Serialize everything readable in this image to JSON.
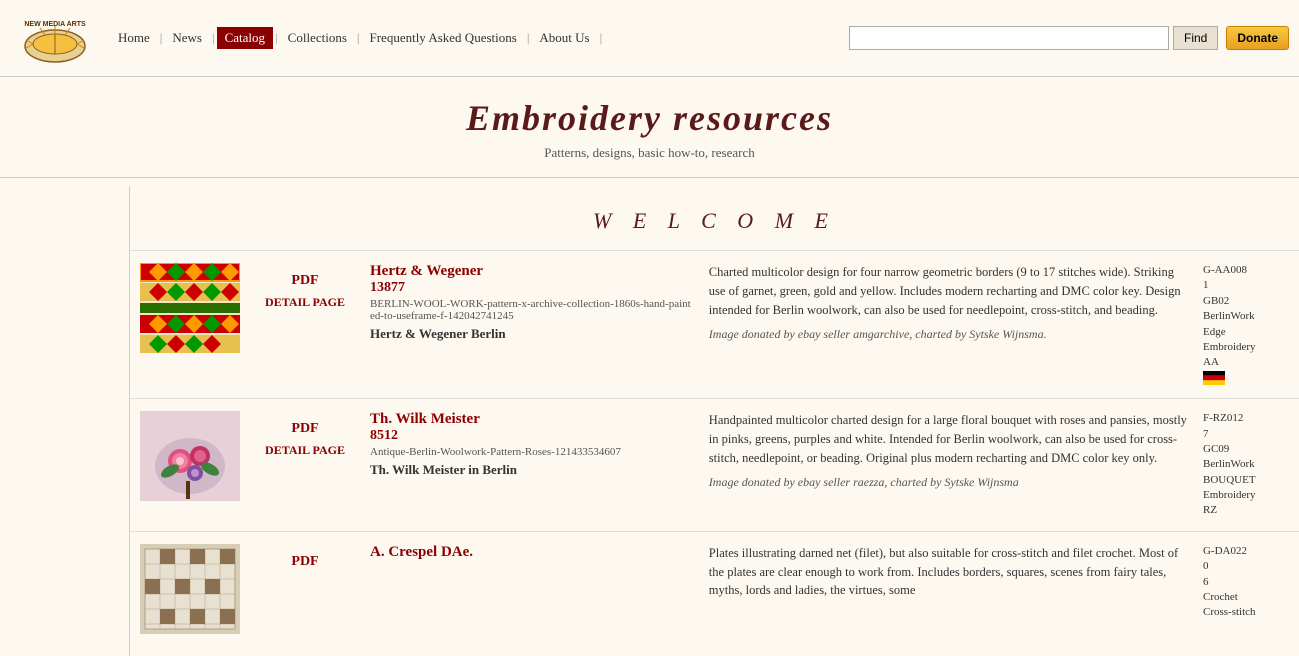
{
  "logo": {
    "alt": "New Media Arts logo"
  },
  "nav": {
    "home": "Home",
    "news": "News",
    "catalog": "Catalog",
    "collections": "Collections",
    "faq": "Frequently Asked Questions",
    "about": "About Us",
    "search_placeholder": "",
    "find_btn": "Find",
    "donate_btn": "Donate"
  },
  "page": {
    "title": "Embroidery resources",
    "subtitle": "Patterns, designs, basic how-to, research"
  },
  "welcome": "W E L C O M E",
  "items": [
    {
      "id": "item1",
      "pdf_label": "PDF",
      "detail_label": "DETAIL PAGE",
      "title": "Hertz & Wegener",
      "number": "13877",
      "archive": "BERLIN-WOOL-WORK-pattern-x-archive-collection-1860s-hand-painted-to-useframe-f-142042741245",
      "publisher": "Hertz & Wegener Berlin",
      "description": "Charted multicolor design for four narrow geometric borders (9 to 17 stitches wide). Striking use of garnet, green, gold and yellow. Includes modern recharting and DMC color key. Design intended for Berlin woolwork, can also be used for needlepoint, cross-stitch, and beading.",
      "donated": "Image donated by ebay seller amgarchive, charted by Sytske Wijnsma.",
      "codes": [
        "G-AA008",
        "1",
        "GB02",
        "BerlinWork",
        "Edge",
        "Embroidery",
        "AA"
      ],
      "flag": "de"
    },
    {
      "id": "item2",
      "pdf_label": "PDF",
      "detail_label": "DETAIL PAGE",
      "title": "Th. Wilk Meister",
      "number": "8512",
      "archive": "Antique-Berlin-Woolwork-Pattern-Roses-121433534607",
      "publisher": "Th. Wilk Meister in Berlin",
      "description": "Handpainted multicolor charted design for a large floral bouquet with roses and pansies, mostly in pinks, greens, purples and white. Intended for Berlin woolwork, can also be used for cross-stitch, needlepoint, or beading. Original plus modern recharting and DMC color key only.",
      "donated": "Image donated by ebay seller raezza, charted by Sytske Wijnsma",
      "codes": [
        "F-RZ012",
        "7",
        "GC09",
        "BerlinWork",
        "BOUQUET",
        "Embroidery",
        "RZ"
      ],
      "flag": ""
    },
    {
      "id": "item3",
      "pdf_label": "PDF",
      "detail_label": "",
      "title": "A. Crespel DAe.",
      "number": "",
      "archive": "",
      "publisher": "",
      "description": "Plates illustrating darned net (filet), but also suitable for cross-stitch and filet crochet. Most of the plates are clear enough to work from. Includes borders, squares, scenes from fairy tales, myths, lords and ladies, the virtues, some",
      "donated": "",
      "codes": [
        "G-DA022",
        "0",
        "6",
        "Crochet",
        "Cross-stitch"
      ],
      "flag": ""
    }
  ]
}
